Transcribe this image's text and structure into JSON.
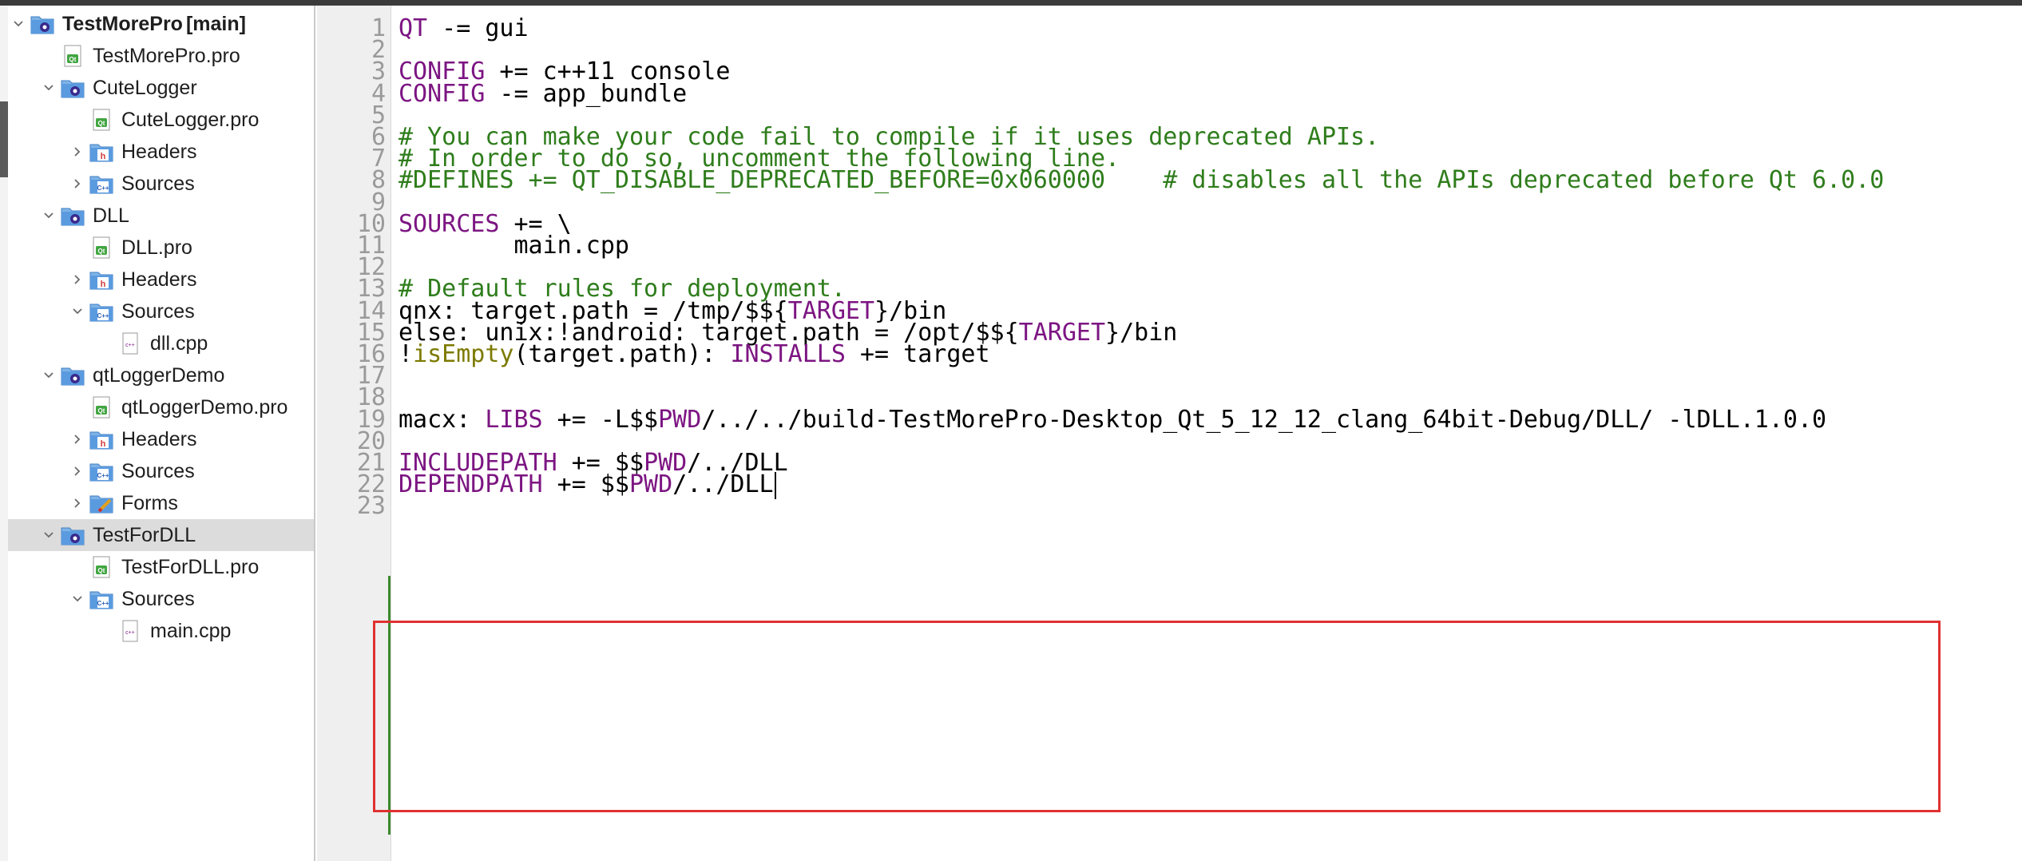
{
  "tree": {
    "root": {
      "name": "TestMorePro",
      "branch": "[main]"
    },
    "items": [
      {
        "label": "TestMorePro.pro"
      },
      {
        "label": "CuteLogger"
      },
      {
        "label": "CuteLogger.pro"
      },
      {
        "label": "Headers"
      },
      {
        "label": "Sources"
      },
      {
        "label": "DLL"
      },
      {
        "label": "DLL.pro"
      },
      {
        "label": "Headers"
      },
      {
        "label": "Sources"
      },
      {
        "label": "dll.cpp"
      },
      {
        "label": "qtLoggerDemo"
      },
      {
        "label": "qtLoggerDemo.pro"
      },
      {
        "label": "Headers"
      },
      {
        "label": "Sources"
      },
      {
        "label": "Forms"
      },
      {
        "label": "TestForDLL"
      },
      {
        "label": "TestForDLL.pro"
      },
      {
        "label": "Sources"
      },
      {
        "label": "main.cpp"
      }
    ]
  },
  "editor": {
    "lines": [
      {
        "n": "1",
        "segs": [
          {
            "t": "QT",
            "c": "kw"
          },
          {
            "t": " -= gui",
            "c": ""
          }
        ]
      },
      {
        "n": "2",
        "segs": []
      },
      {
        "n": "3",
        "segs": [
          {
            "t": "CONFIG",
            "c": "kw"
          },
          {
            "t": " += c++11 console",
            "c": ""
          }
        ]
      },
      {
        "n": "4",
        "segs": [
          {
            "t": "CONFIG",
            "c": "kw"
          },
          {
            "t": " -= app_bundle",
            "c": ""
          }
        ]
      },
      {
        "n": "5",
        "segs": []
      },
      {
        "n": "6",
        "segs": [
          {
            "t": "# You can make your code fail to compile if it uses deprecated APIs.",
            "c": "cm"
          }
        ]
      },
      {
        "n": "7",
        "segs": [
          {
            "t": "# In order to do so, uncomment the following line.",
            "c": "cm"
          }
        ]
      },
      {
        "n": "8",
        "segs": [
          {
            "t": "#DEFINES += QT_DISABLE_DEPRECATED_BEFORE=0x060000    # disables all the APIs deprecated before Qt 6.0.0",
            "c": "cm"
          }
        ]
      },
      {
        "n": "9",
        "segs": []
      },
      {
        "n": "10",
        "segs": [
          {
            "t": "SOURCES",
            "c": "kw"
          },
          {
            "t": " += \\",
            "c": ""
          }
        ]
      },
      {
        "n": "11",
        "segs": [
          {
            "t": "        main.cpp",
            "c": ""
          }
        ]
      },
      {
        "n": "12",
        "segs": []
      },
      {
        "n": "13",
        "segs": [
          {
            "t": "# Default rules for deployment.",
            "c": "cm"
          }
        ]
      },
      {
        "n": "14",
        "segs": [
          {
            "t": "qnx: target.path = /tmp/$${",
            "c": ""
          },
          {
            "t": "TARGET",
            "c": "kw"
          },
          {
            "t": "}/bin",
            "c": ""
          }
        ]
      },
      {
        "n": "15",
        "segs": [
          {
            "t": "else: unix:!android: target.path = /opt/$${",
            "c": ""
          },
          {
            "t": "TARGET",
            "c": "kw"
          },
          {
            "t": "}/bin",
            "c": ""
          }
        ]
      },
      {
        "n": "16",
        "segs": [
          {
            "t": "!",
            "c": ""
          },
          {
            "t": "isEmpty",
            "c": "fn"
          },
          {
            "t": "(target.path): ",
            "c": ""
          },
          {
            "t": "INSTALLS",
            "c": "kw"
          },
          {
            "t": " += target",
            "c": ""
          }
        ]
      },
      {
        "n": "17",
        "segs": []
      },
      {
        "n": "18",
        "segs": []
      },
      {
        "n": "19",
        "segs": [
          {
            "t": "macx: ",
            "c": ""
          },
          {
            "t": "LIBS",
            "c": "kw"
          },
          {
            "t": " += -L$$",
            "c": ""
          },
          {
            "t": "PWD",
            "c": "kw"
          },
          {
            "t": "/../../build-TestMorePro-Desktop_Qt_5_12_12_clang_64bit-Debug/DLL/ -lDLL.1.0.0",
            "c": ""
          }
        ]
      },
      {
        "n": "20",
        "segs": []
      },
      {
        "n": "21",
        "segs": [
          {
            "t": "INCLUDEPATH",
            "c": "kw"
          },
          {
            "t": " += $$",
            "c": ""
          },
          {
            "t": "PWD",
            "c": "kw"
          },
          {
            "t": "/../DLL",
            "c": ""
          }
        ]
      },
      {
        "n": "22",
        "segs": [
          {
            "t": "DEPENDPATH",
            "c": "kw"
          },
          {
            "t": " += $$",
            "c": ""
          },
          {
            "t": "PWD",
            "c": "kw"
          },
          {
            "t": "/../DLL",
            "c": ""
          }
        ]
      },
      {
        "n": "23",
        "segs": []
      }
    ]
  },
  "icons": [
    "chevron-down-icon",
    "chevron-right-icon",
    "project-folder-icon",
    "pro-file-icon",
    "headers-folder-icon",
    "sources-folder-icon",
    "forms-folder-icon",
    "cpp-file-icon"
  ],
  "colors": {
    "keyword": "#7c1582",
    "comment": "#2f7d1c",
    "function": "#7d7a00",
    "highlight": "#e03131",
    "modified": "#3c8a2e"
  }
}
